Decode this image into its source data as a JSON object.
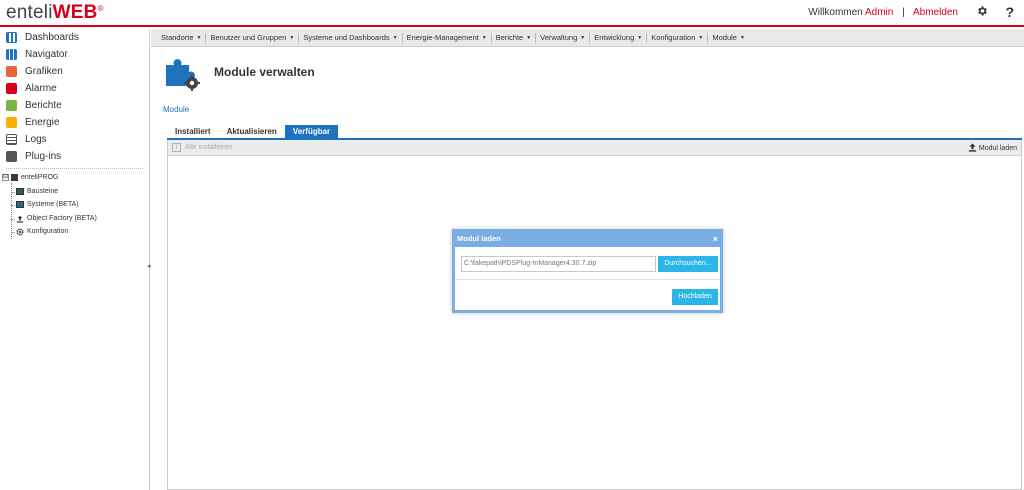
{
  "header": {
    "logo_light": "enteli",
    "logo_bold": "WEB",
    "logo_reg": "®",
    "welcome": "Willkommen",
    "user": "Admin",
    "separator": "|",
    "logout": "Abmelden",
    "settings_icon": "gear-icon",
    "help_icon": "help-icon",
    "help_glyph": "?"
  },
  "sidebar": {
    "items": [
      {
        "label": "Dashboards",
        "icon": "dashboard-icon"
      },
      {
        "label": "Navigator",
        "icon": "navigator-icon"
      },
      {
        "label": "Grafiken",
        "icon": "graphics-icon"
      },
      {
        "label": "Alarme",
        "icon": "alarm-icon"
      },
      {
        "label": "Berichte",
        "icon": "report-icon"
      },
      {
        "label": "Energie",
        "icon": "energy-icon"
      },
      {
        "label": "Logs",
        "icon": "logs-icon"
      },
      {
        "label": "Plug-ins",
        "icon": "plugin-icon"
      }
    ],
    "tree": {
      "root": "enteliPROG",
      "toggle": "⊟",
      "children": [
        {
          "label": "Bausteine",
          "icon": "block-icon"
        },
        {
          "label": "Systeme (BETA)",
          "icon": "monitor-icon"
        },
        {
          "label": "Object Factory (BETA)",
          "icon": "upload-icon"
        },
        {
          "label": "Konfiguration",
          "icon": "gear-icon"
        }
      ]
    }
  },
  "menu": {
    "items": [
      "Standorte",
      "Benutzer und Gruppen",
      "Systeme und Dashboards",
      "Energie-Management",
      "Berichte",
      "Verwaltung",
      "Entwicklung",
      "Konfiguration",
      "Module"
    ]
  },
  "main": {
    "title": "Module verwalten",
    "breadcrumb": "Module",
    "tabs": [
      {
        "label": "Installiert",
        "active": false
      },
      {
        "label": "Aktualisieren",
        "active": false
      },
      {
        "label": "Verfügbar",
        "active": true
      }
    ],
    "toolbar": {
      "install_all": "Alle installieren",
      "upload_module": "Modul laden"
    }
  },
  "dialog": {
    "title": "Modul laden",
    "close": "×",
    "file_value": "C:\\fakepath\\PDSPlug-InManager4.30.7.zip",
    "browse_label": "Durchsuchen...",
    "upload_label": "Hochladen"
  },
  "colors": {
    "brand_red": "#d6001c",
    "accent_blue": "#1e73be",
    "button_cyan": "#2bb5e9",
    "dialog_header": "#7aaee3"
  }
}
